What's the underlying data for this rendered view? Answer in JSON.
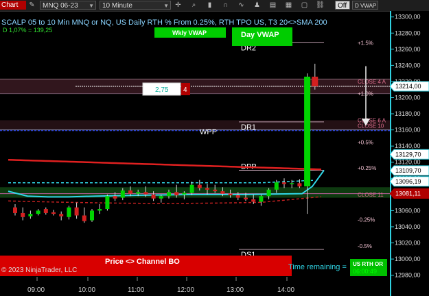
{
  "toolbar": {
    "chart_tab": "Chart",
    "instrument": "MNQ 06-23",
    "interval": "10 Minute",
    "off_label": "Off",
    "d_vwap_label": "D VWAP",
    "icons": [
      "draw-tool-icon",
      "crosshair-icon",
      "zoom-icon",
      "bar-type-icon",
      "magnet-icon",
      "indicator-icon",
      "strategy-icon",
      "properties-icon",
      "template-icon",
      "window-icon"
    ]
  },
  "chart": {
    "title": "SCALP 05 to 10 Min MNQ or NQ, US Daily RTH % From 0.25%, RTH TPO US, T3 20<>SMA 200",
    "subtitle": "D 1,07% = 139,25",
    "wkly_vwap_label": "Wkly VWAP",
    "day_vwap_label": "Day VWAP",
    "order_qty": "2,75",
    "order_count": "4",
    "wpp_label": "WPP",
    "copyright": "© 2023 NinjaTrader, LLC",
    "price_channel_label": "Price <> Channel BO",
    "time_remaining_label": "Time remaining =",
    "time_remaining_value": "06:00:49",
    "session_badge": "US RTH OR",
    "colors": {
      "bull": "#00d400",
      "bear": "#d42020",
      "vwap": "#e02020",
      "cyan": "#30d8e8",
      "zone": "#0e3a10",
      "band": "#3a1a22",
      "banner": "#d80000",
      "scale_border": "#30d0e0"
    }
  },
  "levels": [
    {
      "label": "DR2",
      "price": 13268
    },
    {
      "label": "DR1",
      "price": 13170
    },
    {
      "label": "DPP",
      "price": 13110
    },
    {
      "label": "DS1",
      "price": 13012
    }
  ],
  "pct_labels": [
    {
      "label": "+1.5%",
      "price": 13268
    },
    {
      "label": "+1.0%",
      "price": 13205
    },
    {
      "label": "+0.5%",
      "price": 13145
    },
    {
      "label": "+0.25%",
      "price": 13113
    },
    {
      "label": "-0.25%",
      "price": 13049
    },
    {
      "label": "-0.5%",
      "price": 13016
    }
  ],
  "close_labels": [
    {
      "label": "CLOSE 4 A",
      "price": 13220
    },
    {
      "label": "CLOSE 6 A",
      "price": 13172
    },
    {
      "label": "CLOSE 10",
      "price": 13165
    },
    {
      "label": "CLOSE 11",
      "price": 13080
    }
  ],
  "price_axis": {
    "ticks": [
      "13300,00",
      "13280,00",
      "13260,00",
      "13240,00",
      "13220,00",
      "13200,00",
      "13180,00",
      "13160,00",
      "13140,00",
      "13120,00",
      "13100,00",
      "13080,00",
      "13060,00",
      "13040,00",
      "13020,00",
      "13000,00",
      "12980,00"
    ],
    "range": [
      12978,
      13304
    ],
    "markers": [
      {
        "value": "13214,00",
        "price": 13214,
        "style": "white"
      },
      {
        "value": "13129,70",
        "price": 13129.7,
        "style": "white"
      },
      {
        "value": "13109,70",
        "price": 13109.7,
        "style": "white"
      },
      {
        "value": "13096,19",
        "price": 13096.19,
        "style": "white"
      },
      {
        "value": "13081,11",
        "price": 13081.11,
        "style": "red"
      }
    ]
  },
  "time_axis": {
    "labels": [
      "09:00",
      "10:00",
      "11:00",
      "12:00",
      "13:00",
      "14:00"
    ]
  },
  "chart_data": {
    "type": "candlestick",
    "title": "SCALP 05 to 10 Min MNQ or NQ, US Daily RTH % From 0.25%, RTH TPO US, T3 20<>SMA 200",
    "ylim": [
      12978,
      13304
    ],
    "bar_interval": "10 Minute",
    "bars": [
      {
        "o": 13064,
        "h": 13068,
        "l": 13054,
        "c": 13057
      },
      {
        "o": 13057,
        "h": 13064,
        "l": 13048,
        "c": 13052
      },
      {
        "o": 13053,
        "h": 13060,
        "l": 13050,
        "c": 13056
      },
      {
        "o": 13056,
        "h": 13062,
        "l": 13054,
        "c": 13060
      },
      {
        "o": 13062,
        "h": 13064,
        "l": 13055,
        "c": 13057
      },
      {
        "o": 13058,
        "h": 13061,
        "l": 13054,
        "c": 13056
      },
      {
        "o": 13056,
        "h": 13059,
        "l": 13048,
        "c": 13053
      },
      {
        "o": 13052,
        "h": 13066,
        "l": 13049,
        "c": 13064
      },
      {
        "o": 13064,
        "h": 13070,
        "l": 13050,
        "c": 13054
      },
      {
        "o": 13054,
        "h": 13064,
        "l": 13045,
        "c": 13047
      },
      {
        "o": 13048,
        "h": 13062,
        "l": 13046,
        "c": 13060
      },
      {
        "o": 13060,
        "h": 13068,
        "l": 13056,
        "c": 13062
      },
      {
        "o": 13062,
        "h": 13080,
        "l": 13060,
        "c": 13078
      },
      {
        "o": 13078,
        "h": 13083,
        "l": 13072,
        "c": 13075
      },
      {
        "o": 13076,
        "h": 13088,
        "l": 13073,
        "c": 13085
      },
      {
        "o": 13085,
        "h": 13090,
        "l": 13078,
        "c": 13081
      },
      {
        "o": 13081,
        "h": 13086,
        "l": 13078,
        "c": 13083
      },
      {
        "o": 13083,
        "h": 13090,
        "l": 13077,
        "c": 13080
      },
      {
        "o": 13080,
        "h": 13084,
        "l": 13072,
        "c": 13075
      },
      {
        "o": 13075,
        "h": 13080,
        "l": 13070,
        "c": 13078
      },
      {
        "o": 13078,
        "h": 13086,
        "l": 13075,
        "c": 13083
      },
      {
        "o": 13083,
        "h": 13092,
        "l": 13076,
        "c": 13079
      },
      {
        "o": 13080,
        "h": 13084,
        "l": 13074,
        "c": 13082
      },
      {
        "o": 13082,
        "h": 13096,
        "l": 13079,
        "c": 13092
      },
      {
        "o": 13092,
        "h": 13098,
        "l": 13085,
        "c": 13088
      },
      {
        "o": 13088,
        "h": 13093,
        "l": 13080,
        "c": 13086
      },
      {
        "o": 13086,
        "h": 13092,
        "l": 13082,
        "c": 13084
      },
      {
        "o": 13084,
        "h": 13089,
        "l": 13078,
        "c": 13081
      },
      {
        "o": 13081,
        "h": 13086,
        "l": 13076,
        "c": 13079
      },
      {
        "o": 13079,
        "h": 13083,
        "l": 13073,
        "c": 13076
      },
      {
        "o": 13076,
        "h": 13082,
        "l": 13072,
        "c": 13074
      },
      {
        "o": 13074,
        "h": 13080,
        "l": 13068,
        "c": 13071
      },
      {
        "o": 13071,
        "h": 13080,
        "l": 13066,
        "c": 13078
      },
      {
        "o": 13078,
        "h": 13088,
        "l": 13074,
        "c": 13086
      },
      {
        "o": 13086,
        "h": 13098,
        "l": 13082,
        "c": 13095
      },
      {
        "o": 13095,
        "h": 13100,
        "l": 13088,
        "c": 13093
      },
      {
        "o": 13093,
        "h": 13098,
        "l": 13088,
        "c": 13094
      },
      {
        "o": 13094,
        "h": 13099,
        "l": 13088,
        "c": 13090
      },
      {
        "o": 13090,
        "h": 13230,
        "l": 13056,
        "c": 13226
      },
      {
        "o": 13226,
        "h": 13242,
        "l": 13210,
        "c": 13214
      }
    ]
  }
}
